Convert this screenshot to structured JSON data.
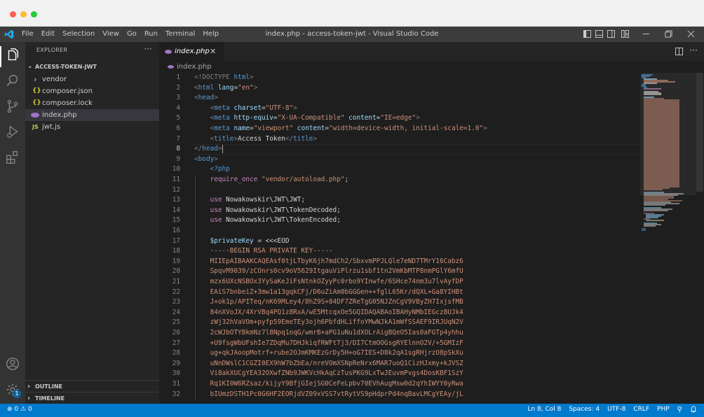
{
  "window": {
    "title": "index.php - access-token-jwt - Visual Studio Code"
  },
  "menu": [
    "File",
    "Edit",
    "Selection",
    "View",
    "Go",
    "Run",
    "Terminal",
    "Help"
  ],
  "activity_bar": {
    "icons": [
      "files-icon",
      "search-icon",
      "source-control-icon",
      "run-debug-icon",
      "extensions-icon",
      "account-icon",
      "settings-gear-icon"
    ],
    "settings_badge": "1"
  },
  "sidebar": {
    "header": "EXPLORER",
    "more": "···",
    "folder": "ACCESS-TOKEN-JWT",
    "items": [
      {
        "label": "vendor",
        "icon": "›",
        "icon_color": "#cccccc"
      },
      {
        "label": "composer.json",
        "icon": "{}",
        "icon_color": "#cbcb41"
      },
      {
        "label": "composer.lock",
        "icon": "{}",
        "icon_color": "#cbcb41"
      },
      {
        "label": "index.php",
        "icon": "php",
        "icon_color": "#a074c4"
      },
      {
        "label": "jwt.js",
        "icon": "JS",
        "icon_color": "#cbcb41"
      }
    ],
    "outline": "OUTLINE",
    "timeline": "TIMELINE"
  },
  "tab": {
    "label": "index.php",
    "close": "✕"
  },
  "breadcrumb": "index.php",
  "editor": {
    "current_line": 8,
    "lines": [
      "1",
      "2",
      "3",
      "4",
      "5",
      "6",
      "7",
      "8",
      "9",
      "10",
      "11",
      "12",
      "13",
      "14",
      "15",
      "16",
      "17",
      "18",
      "19",
      "20",
      "21",
      "22",
      "23",
      "24",
      "25",
      "26",
      "27",
      "28",
      "29",
      "30",
      "31",
      "32"
    ],
    "code": {
      "l1": {
        "a": "<!DOCTYPE ",
        "b": "html",
        "c": ">"
      },
      "l2": {
        "a": "<",
        "b": "html",
        "c": " lang",
        "d": "=",
        "e": "\"en\"",
        "f": ">"
      },
      "l3": {
        "a": "<",
        "b": "head",
        "c": ">"
      },
      "l4": {
        "a": "<",
        "b": "meta",
        "c": " charset",
        "d": "=",
        "e": "\"UTF-8\"",
        "f": ">"
      },
      "l5": {
        "a": "<",
        "b": "meta",
        "c": " http-equiv",
        "d": "=",
        "e": "\"X-UA-Compatible\"",
        "f": " content",
        "g": "=",
        "h": "\"IE=edge\"",
        "i": ">"
      },
      "l6": {
        "a": "<",
        "b": "meta",
        "c": " name",
        "d": "=",
        "e": "\"viewport\"",
        "f": " content",
        "g": "=",
        "h": "\"width=device-width, initial-scale=1.0\"",
        "i": ">"
      },
      "l7": {
        "a": "<",
        "b": "title",
        "c": ">",
        "d": "Access Token",
        "e": "</",
        "f": "title",
        "g": ">"
      },
      "l8": {
        "a": "</",
        "b": "head",
        "c": ">"
      },
      "l9": {
        "a": "<",
        "b": "body",
        "c": ">"
      },
      "l10": "<?php",
      "l11": {
        "a": "require_once",
        "b": " \"vendor/autoload.php\"",
        "c": ";"
      },
      "l13": {
        "a": "use",
        "b": " Nowakowskir\\JWT\\JWT;"
      },
      "l14": {
        "a": "use",
        "b": " Nowakowskir\\JWT\\TokenDecoded;"
      },
      "l15": {
        "a": "use",
        "b": " Nowakowskir\\JWT\\TokenEncoded;"
      },
      "l17": {
        "a": "$privateKey",
        "b": " = ",
        "c": "<<<EOD"
      },
      "l18": "-----BEGIN RSA PRIVATE KEY-----",
      "l19": "MIIEpAIBAAKCAQEAsf0tjLTbyK6jh7mdCh2/SbxvmPPJLQle7eND7TMrY16Cabz6",
      "l20": "SpqvM9039/zCOnrs0cv9oV5629ItgauViPlrzu1sbf1tn2VmKbMTP8nmPGlY6mfU",
      "l21": "mzx6UXcNSBOx3YySaKeJiFsNtnkOZyyPc0rbo9YInwfe/6SHce74nm3u7lvAyfDP",
      "l22": "EAiS7bnbeiZ+3mw1a13gqkCFj/D6uZiAm0bGGGen++fglL65Kr/dQXL+Ga8YIHBt",
      "l23": "J+ok1p/APITeq/nK69MLey4/8hZ9S+84DF7ZReTgG05NJZnCgV9VByZH7IxjsfMB",
      "l24": "84nXVoJX/4XrVBq4PQ1z8RxA/wE5MtcqxOe5GQIDAQABAoIBAHyNMbIEGcz8UJk4",
      "l25": "zWj32hVaVOm+pyfp59EmeTEy3ojh6PbfdHLiffoYMwNJkA1mWfSSAEF9IRJUqN2V",
      "l26": "2cWJbOTYBkmNz7l8Npq1oqG/wmrB+aPG1uNu1dXOLrAigBQeO5Ias0aFGTp4yhhu",
      "l27": "+U9fsgWbUFshIe7ZDqMu7DHJkiqfRWFtTj3/DI7CtmOOGsgRYElnnO2V/+5GMIzF",
      "l28": "ug+qkJAoopMotrf+rube2OJmKMKEzGrDy5H+oG7IES+D8k2qA1sgRHjrzO8pSkXu",
      "l29": "uNnDWslC1CGZI0EX9hW7bZbEa/nreVOmXSNpReNrx6MAR7uoQ1CizHJxmy+kJVSZ",
      "l30": "Vi8akXUCgYEA32OXwfZNb9JWKVcHkAqCzTusPKG9LxTwJEuvmPvgs4DosKBF1SzY",
      "l31": "Rq1KI0W6RZsaz/kijyY9BfjGIejSG0CeFeLpbv70EVhAugMsw0d2qYhIWYY0yRwa",
      "l32": "bIUmzDSTH1Pc0G6HF2EORjdVZ09xVSS7vtRytVS9pHdprPd4nqBavLMCgYEAy/jL"
    }
  },
  "status_bar": {
    "errors": "0",
    "warnings": "0",
    "position": "Ln 8, Col 8",
    "spaces": "Spaces: 4",
    "encoding": "UTF-8",
    "eol": "CRLF",
    "language": "PHP"
  },
  "colors": {
    "os_dot_red": "#ff5f56",
    "os_dot_yellow": "#ffbd2e",
    "os_dot_green": "#27c93f",
    "accent": "#007acc"
  }
}
